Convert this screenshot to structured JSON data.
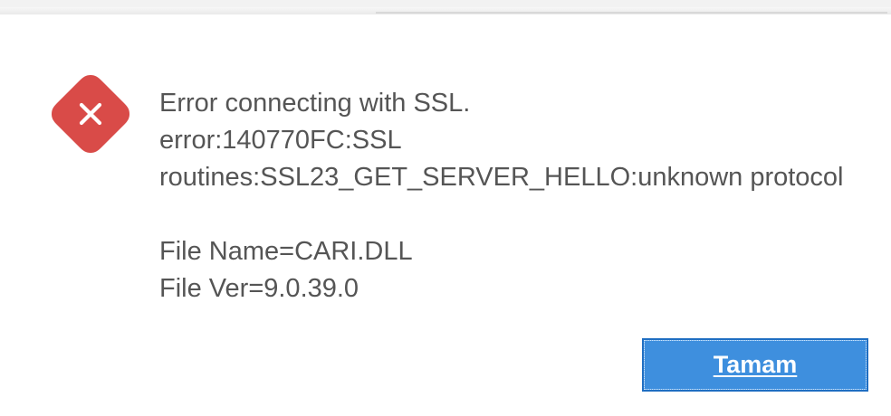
{
  "dialog": {
    "icon": "error-icon",
    "message_lines": [
      "Error connecting with SSL.",
      "error:140770FC:SSL",
      "routines:SSL23_GET_SERVER_HELLO:unknown protocol"
    ],
    "file_name": "File Name=CARI.DLL",
    "file_version": "File Ver=9.0.39.0",
    "ok_button_label": "Tamam"
  },
  "colors": {
    "error_icon": "#d94b48",
    "text": "#555555",
    "button": "#3e8fde",
    "button_border": "#1f6ec2"
  }
}
